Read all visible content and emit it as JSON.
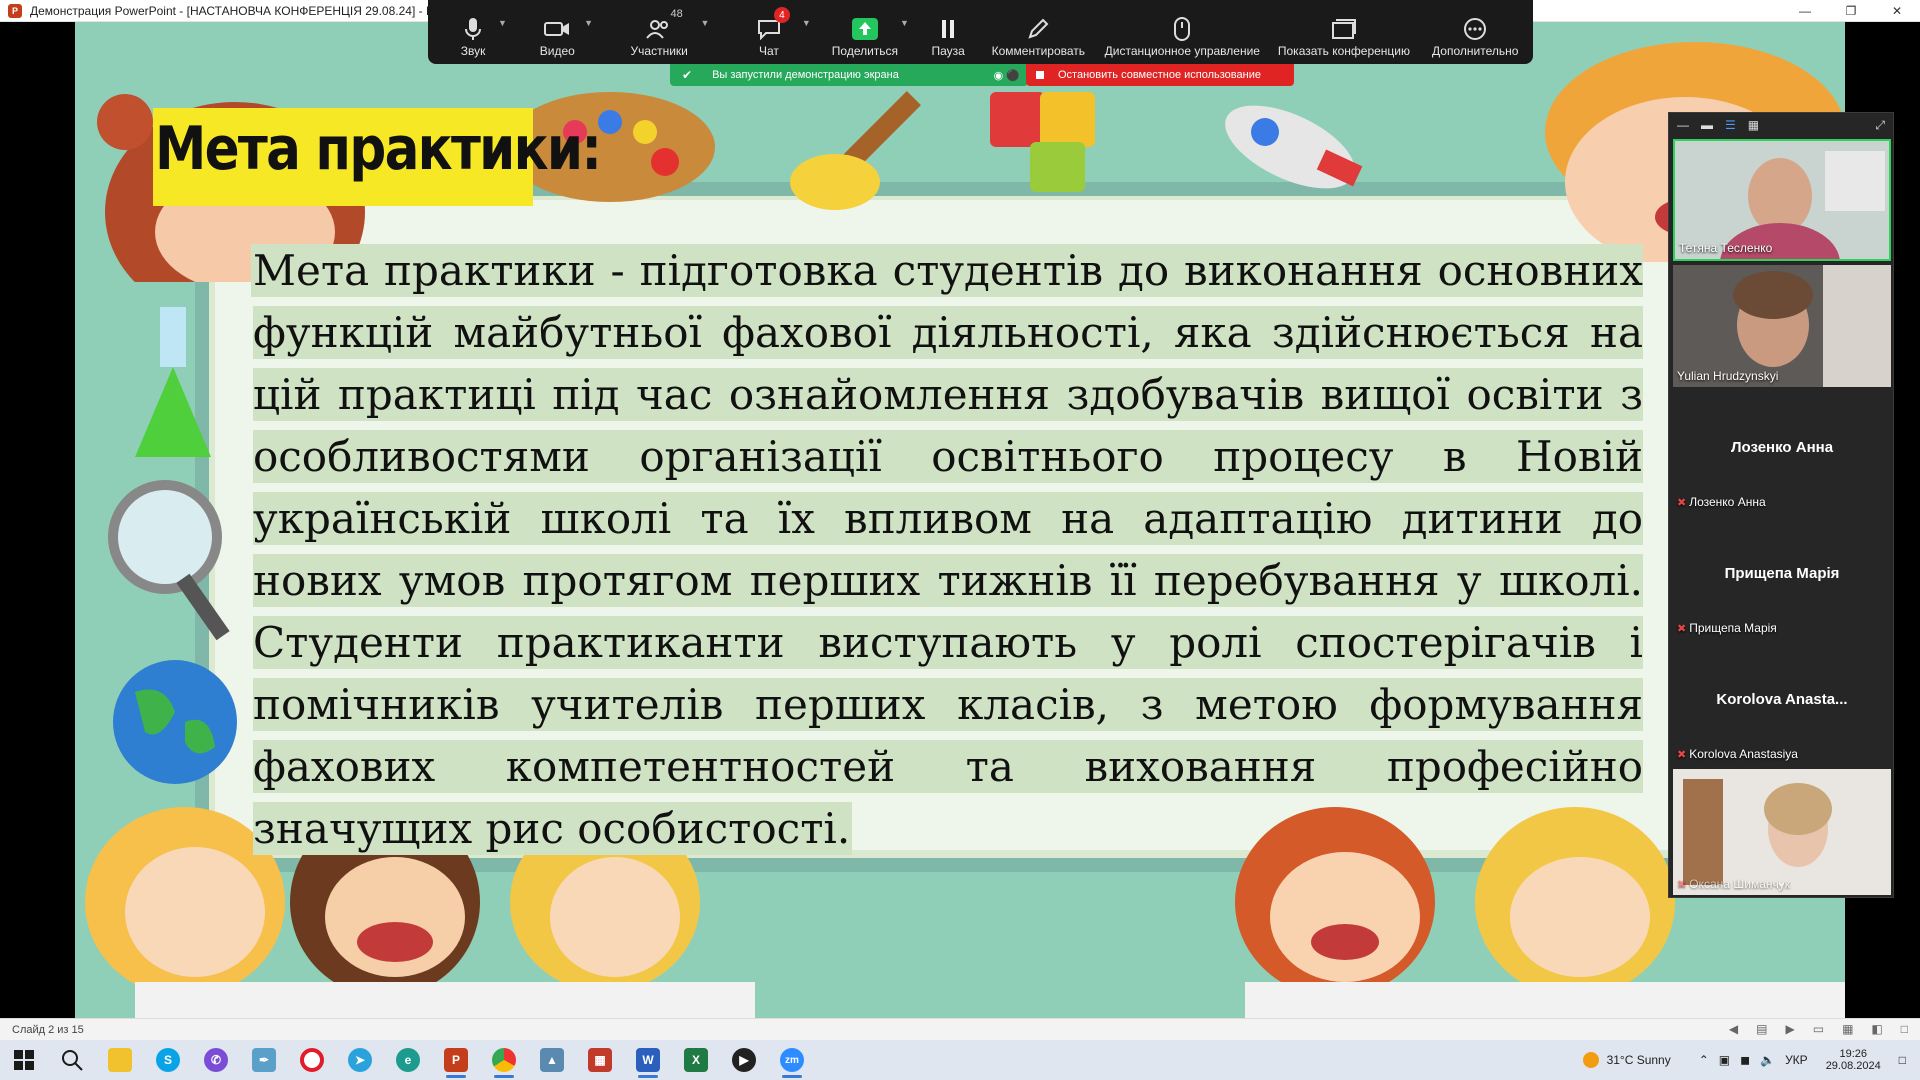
{
  "window": {
    "title": "Демонстрация PowerPoint - [НАСТАНОВЧА КОНФЕРЕНЦІЯ 29.08.24] - P",
    "app_icon_letter": "P"
  },
  "zoom_toolbar": {
    "items": [
      {
        "label": "Звук",
        "icon": "microphone-icon"
      },
      {
        "label": "Видео",
        "icon": "camera-icon"
      },
      {
        "label": "Участники",
        "icon": "participants-icon",
        "count": "48"
      },
      {
        "label": "Чат",
        "icon": "chat-icon",
        "badge": "4"
      },
      {
        "label": "Поделиться",
        "icon": "share-icon"
      },
      {
        "label": "Пауза",
        "icon": "pause-icon"
      },
      {
        "label": "Комментировать",
        "icon": "annotate-icon"
      },
      {
        "label": "Дистанционное управление",
        "icon": "remote-control-icon"
      },
      {
        "label": "Показать конференцию",
        "icon": "show-meeting-icon"
      },
      {
        "label": "Дополнительно",
        "icon": "more-icon"
      }
    ],
    "share_notice": "Вы запустили демонстрацию экрана",
    "stop_share": "Остановить совместное использование"
  },
  "slide": {
    "title": "Мета практики:",
    "body": "Мета практики - підготовка студентів до виконання основних функцій майбутньої фахової діяльності, яка здійснюється на цій практиці під час ознайомлення здобувачів вищої освіти з особливостями організації освітнього процесу в Новій українській школі та їх впливом на адаптацію дитини до нових умов протягом перших тижнів її перебування у школі. Студенти практиканти виступають у ролі спостерігачів і помічників учителів перших класів, з метою формування фахових компетентностей та виховання професійно значущих рис особистості."
  },
  "participants": [
    {
      "name": "Тетяна Тесленко",
      "video": true
    },
    {
      "name": "Yulian Hrudzynskyi",
      "video": true
    },
    {
      "display": "Лозенко Анна",
      "name": "Лозенко Анна",
      "video": false,
      "muted": true
    },
    {
      "display": "Прищепа Марія",
      "name": "Прищепа Марія",
      "video": false,
      "muted": true
    },
    {
      "display": "Korolova Anasta...",
      "name": "Korolova Anastasiya",
      "video": false,
      "muted": true
    },
    {
      "name": "Оксана Шиманчук",
      "video": true
    }
  ],
  "statusbar": {
    "slide_info": "Слайд 2 из 15"
  },
  "taskbar": {
    "weather": "31°C  Sunny",
    "lang": "УКР",
    "time": "19:26",
    "date": "29.08.2024"
  }
}
